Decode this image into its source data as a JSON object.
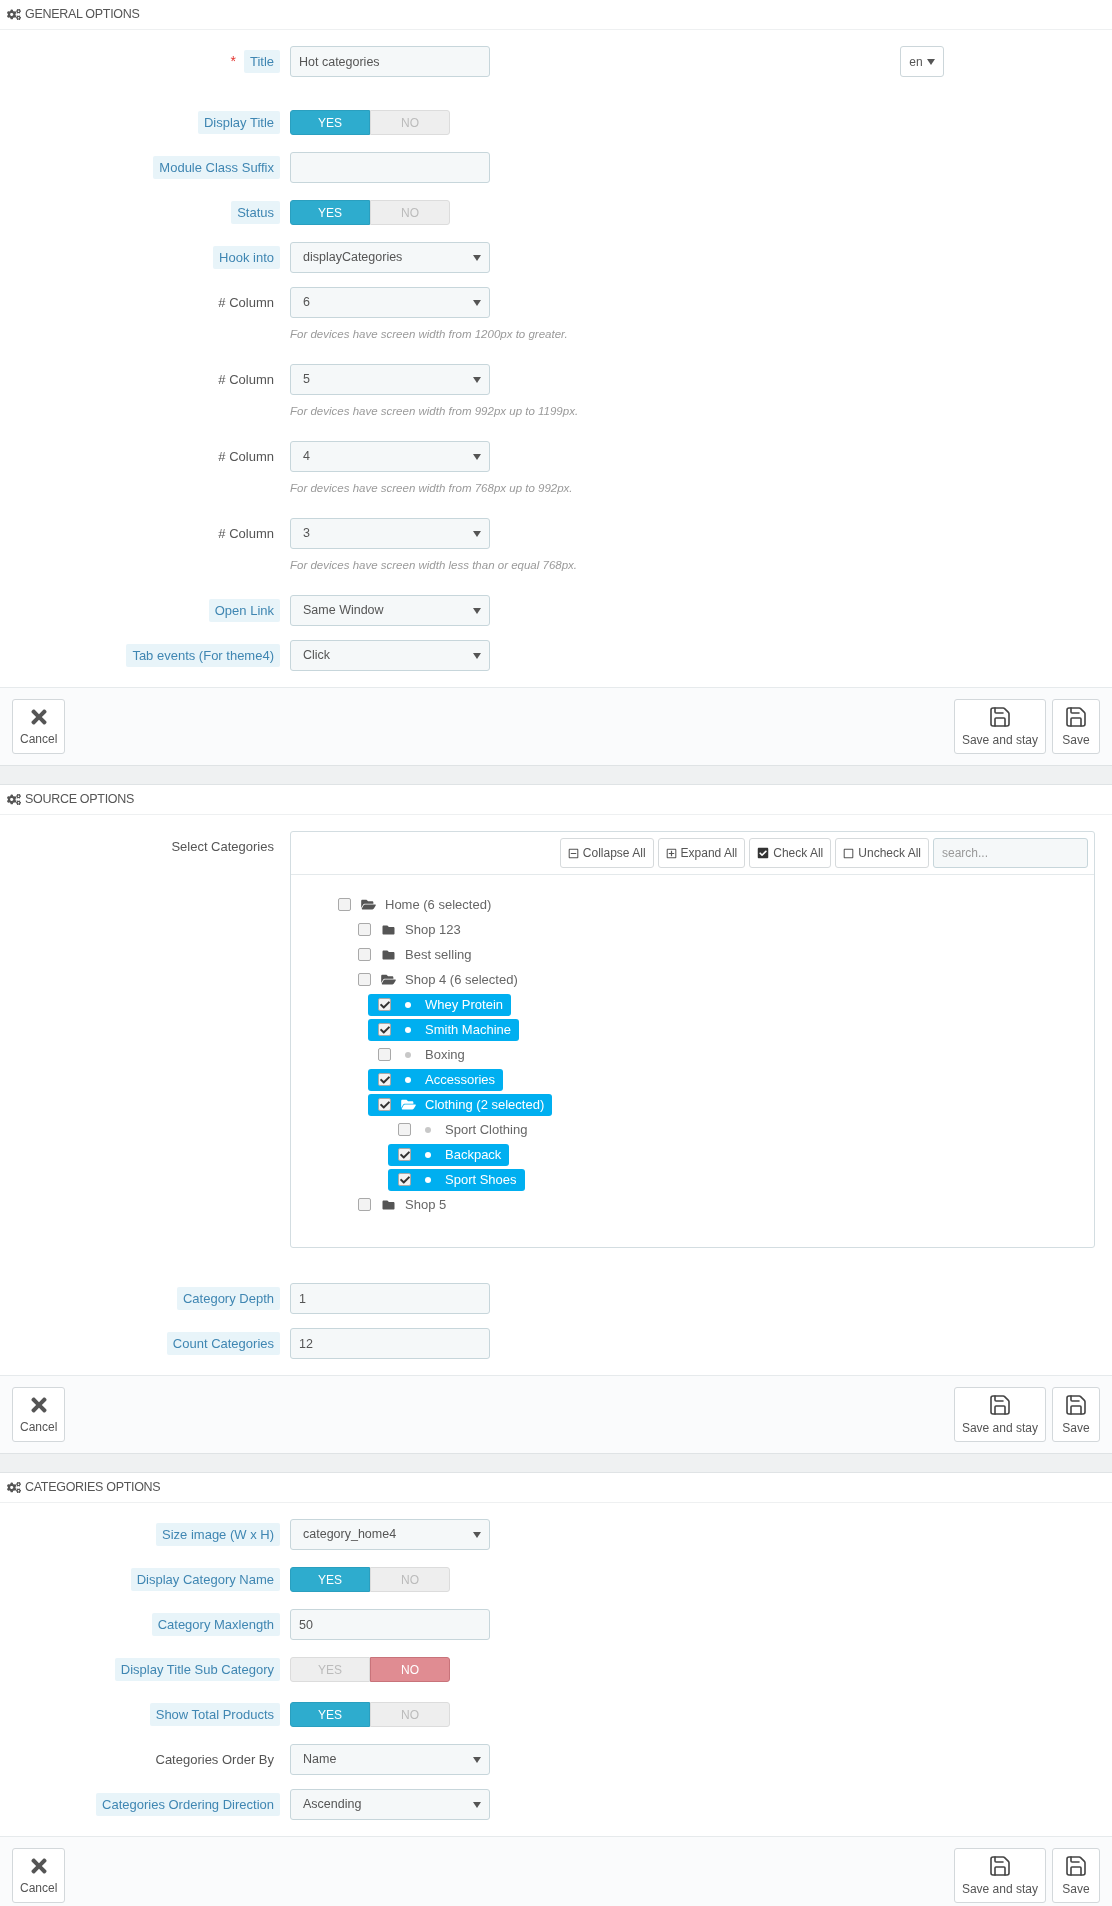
{
  "sections": [
    {
      "title": "GENERAL OPTIONS",
      "fields": [
        {
          "kind": "text",
          "label": "Title",
          "hint": true,
          "required_mark": "*",
          "value": "Hot categories",
          "lang": "en"
        },
        {
          "kind": "switch",
          "label": "Display Title",
          "hint": true,
          "options": [
            {
              "label": "YES",
              "selected": true
            },
            {
              "label": "NO",
              "selected": false
            }
          ]
        },
        {
          "kind": "text",
          "label": "Module Class Suffix",
          "hint": true
        },
        {
          "kind": "switch",
          "label": "Status",
          "hint": true,
          "options": [
            {
              "label": "YES",
              "selected": true
            },
            {
              "label": "NO",
              "selected": false
            }
          ]
        },
        {
          "kind": "select",
          "label": "Hook into",
          "hint": true,
          "value": "displayCategories"
        },
        {
          "kind": "select",
          "label": "# Column",
          "hint": false,
          "value": "6",
          "help": "For devices have screen width from 1200px to greater."
        },
        {
          "kind": "select",
          "label": "# Column",
          "hint": false,
          "value": "5",
          "help": "For devices have screen width from 992px up to 1199px."
        },
        {
          "kind": "select",
          "label": "# Column",
          "hint": false,
          "value": "4",
          "help": "For devices have screen width from 768px up to 992px."
        },
        {
          "kind": "select",
          "label": "# Column",
          "hint": false,
          "value": "3",
          "help": "For devices have screen width less than or equal 768px."
        },
        {
          "kind": "select",
          "label": "Open Link",
          "hint": true,
          "value": "Same Window"
        },
        {
          "kind": "select",
          "label": "Tab events (For theme4)",
          "hint": true,
          "value": "Click"
        }
      ],
      "buttons": [
        {
          "kind": "cancel",
          "label": "Cancel"
        },
        {
          "kind": "save",
          "label": "Save and stay"
        },
        {
          "kind": "save",
          "label": "Save"
        }
      ]
    },
    {
      "title": "SOURCE OPTIONS",
      "fields": [
        {
          "kind": "tree",
          "label": "Select Categories",
          "hint": false,
          "toolbar": [
            {
              "kind": "collapse",
              "label": "Collapse All"
            },
            {
              "kind": "expand",
              "label": "Expand All"
            },
            {
              "kind": "check",
              "label": "Check All"
            },
            {
              "kind": "uncheck",
              "label": "Uncheck All"
            }
          ],
          "search": {
            "placeholder": "search..."
          },
          "nodes": [
            {
              "label": "Home (6 selected)",
              "kind": "folder",
              "expanded": true,
              "checked": false,
              "children": [
                {
                  "label": "Shop 123",
                  "kind": "folder",
                  "expanded": false,
                  "checked": false
                },
                {
                  "label": "Best selling",
                  "kind": "folder",
                  "expanded": false,
                  "checked": false
                },
                {
                  "label": "Shop 4 (6 selected)",
                  "kind": "folder",
                  "expanded": true,
                  "checked": false,
                  "children": [
                    {
                      "label": "Whey Protein",
                      "kind": "leaf",
                      "checked": true
                    },
                    {
                      "label": "Smith Machine",
                      "kind": "leaf",
                      "checked": true
                    },
                    {
                      "label": "Boxing",
                      "kind": "leaf",
                      "checked": false
                    },
                    {
                      "label": "Accessories",
                      "kind": "leaf",
                      "checked": true
                    },
                    {
                      "label": "Clothing (2 selected)",
                      "kind": "folder",
                      "expanded": true,
                      "checked": true,
                      "children": [
                        {
                          "label": "Sport Clothing",
                          "kind": "leaf",
                          "checked": false
                        },
                        {
                          "label": "Backpack",
                          "kind": "leaf",
                          "checked": true
                        },
                        {
                          "label": "Sport Shoes",
                          "kind": "leaf",
                          "checked": true
                        }
                      ]
                    }
                  ]
                },
                {
                  "label": "Shop 5",
                  "kind": "folder",
                  "expanded": false,
                  "checked": false
                }
              ]
            }
          ]
        },
        {
          "kind": "text",
          "label": "Category Depth",
          "hint": true,
          "value": "1"
        },
        {
          "kind": "text",
          "label": "Count Categories",
          "hint": true,
          "value": "12"
        }
      ],
      "buttons": [
        {
          "kind": "cancel",
          "label": "Cancel"
        },
        {
          "kind": "save",
          "label": "Save and stay"
        },
        {
          "kind": "save",
          "label": "Save"
        }
      ]
    },
    {
      "title": "CATEGORIES OPTIONS",
      "fields": [
        {
          "kind": "select",
          "label": "Size image (W x H)",
          "hint": true,
          "value": "category_home4"
        },
        {
          "kind": "switch",
          "label": "Display Category Name",
          "hint": true,
          "options": [
            {
              "label": "YES",
              "selected": true
            },
            {
              "label": "NO",
              "selected": false
            }
          ]
        },
        {
          "kind": "text",
          "label": "Category Maxlength",
          "hint": true,
          "value": "50"
        },
        {
          "kind": "switch",
          "label": "Display Title Sub Category",
          "hint": true,
          "options": [
            {
              "label": "YES",
              "selected": false
            },
            {
              "label": "NO",
              "selected": true
            }
          ]
        },
        {
          "kind": "switch",
          "label": "Show Total Products",
          "hint": true,
          "options": [
            {
              "label": "YES",
              "selected": true
            },
            {
              "label": "NO",
              "selected": false
            }
          ]
        },
        {
          "kind": "select",
          "label": "Categories Order By",
          "hint": false,
          "value": "Name"
        },
        {
          "kind": "select",
          "label": "Categories Ordering Direction",
          "hint": true,
          "value": "Ascending"
        }
      ],
      "buttons": [
        {
          "kind": "cancel",
          "label": "Cancel"
        },
        {
          "kind": "save",
          "label": "Save and stay"
        },
        {
          "kind": "save",
          "label": "Save"
        }
      ]
    }
  ]
}
